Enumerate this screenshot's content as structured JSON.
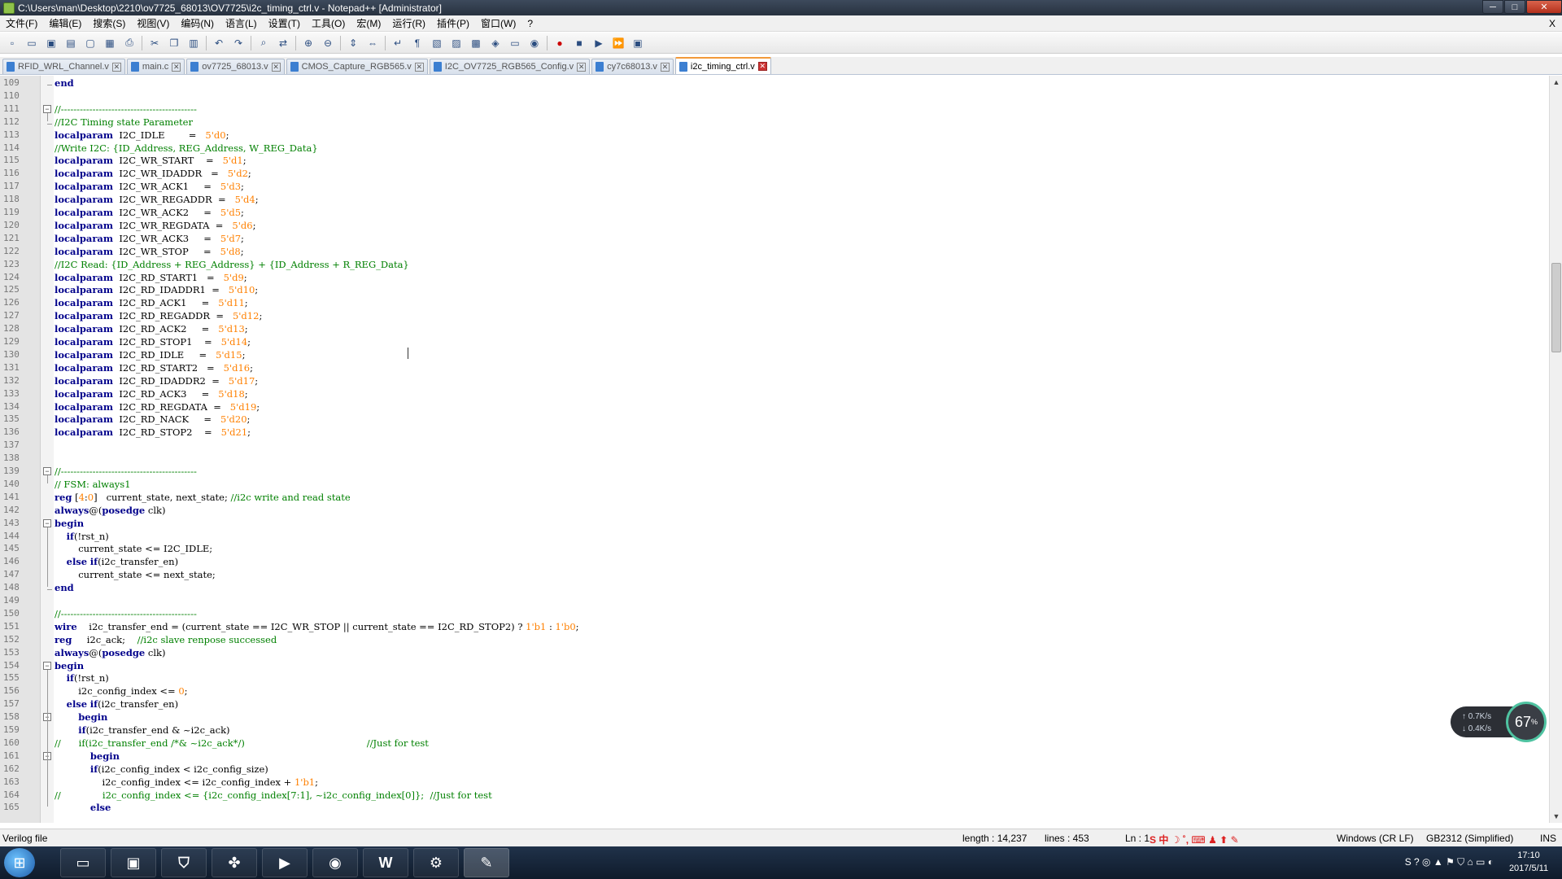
{
  "window": {
    "title": "C:\\Users\\man\\Desktop\\2210\\ov7725_68013\\OV7725\\i2c_timing_ctrl.v - Notepad++ [Administrator]",
    "minimize": "─",
    "maximize": "□",
    "close": "✕"
  },
  "menu": [
    "文件(F)",
    "编辑(E)",
    "搜索(S)",
    "视图(V)",
    "编码(N)",
    "语言(L)",
    "设置(T)",
    "工具(O)",
    "宏(M)",
    "运行(R)",
    "插件(P)",
    "窗口(W)",
    "?"
  ],
  "menu_close": "X",
  "tabs": [
    {
      "label": "RFID_WRL_Channel.v",
      "active": false
    },
    {
      "label": "main.c",
      "active": false
    },
    {
      "label": "ov7725_68013.v",
      "active": false
    },
    {
      "label": "CMOS_Capture_RGB565.v",
      "active": false
    },
    {
      "label": "I2C_OV7725_RGB565_Config.v",
      "active": false
    },
    {
      "label": "cy7c68013.v",
      "active": false
    },
    {
      "label": "i2c_timing_ctrl.v",
      "active": true
    }
  ],
  "code_lines": [
    {
      "n": "109",
      "t": "end"
    },
    {
      "n": "110",
      "t": ""
    },
    {
      "n": "111",
      "t": "//-------------------------------------------"
    },
    {
      "n": "112",
      "t": "//I2C Timing state Parameter"
    },
    {
      "n": "113",
      "t": "localparam  I2C_IDLE        =   5'd0;"
    },
    {
      "n": "114",
      "t": "//Write I2C: {ID_Address, REG_Address, W_REG_Data}"
    },
    {
      "n": "115",
      "t": "localparam  I2C_WR_START    =   5'd1;"
    },
    {
      "n": "116",
      "t": "localparam  I2C_WR_IDADDR   =   5'd2;"
    },
    {
      "n": "117",
      "t": "localparam  I2C_WR_ACK1     =   5'd3;"
    },
    {
      "n": "118",
      "t": "localparam  I2C_WR_REGADDR  =   5'd4;"
    },
    {
      "n": "119",
      "t": "localparam  I2C_WR_ACK2     =   5'd5;"
    },
    {
      "n": "120",
      "t": "localparam  I2C_WR_REGDATA  =   5'd6;"
    },
    {
      "n": "121",
      "t": "localparam  I2C_WR_ACK3     =   5'd7;"
    },
    {
      "n": "122",
      "t": "localparam  I2C_WR_STOP     =   5'd8;"
    },
    {
      "n": "123",
      "t": "//I2C Read: {ID_Address + REG_Address} + {ID_Address + R_REG_Data}"
    },
    {
      "n": "124",
      "t": "localparam  I2C_RD_START1   =   5'd9;"
    },
    {
      "n": "125",
      "t": "localparam  I2C_RD_IDADDR1  =   5'd10;"
    },
    {
      "n": "126",
      "t": "localparam  I2C_RD_ACK1     =   5'd11;"
    },
    {
      "n": "127",
      "t": "localparam  I2C_RD_REGADDR  =   5'd12;"
    },
    {
      "n": "128",
      "t": "localparam  I2C_RD_ACK2     =   5'd13;"
    },
    {
      "n": "129",
      "t": "localparam  I2C_RD_STOP1    =   5'd14;"
    },
    {
      "n": "130",
      "t": "localparam  I2C_RD_IDLE     =   5'd15;"
    },
    {
      "n": "131",
      "t": "localparam  I2C_RD_START2   =   5'd16;"
    },
    {
      "n": "132",
      "t": "localparam  I2C_RD_IDADDR2  =   5'd17;"
    },
    {
      "n": "133",
      "t": "localparam  I2C_RD_ACK3     =   5'd18;"
    },
    {
      "n": "134",
      "t": "localparam  I2C_RD_REGDATA  =   5'd19;"
    },
    {
      "n": "135",
      "t": "localparam  I2C_RD_NACK     =   5'd20;"
    },
    {
      "n": "136",
      "t": "localparam  I2C_RD_STOP2    =   5'd21;"
    },
    {
      "n": "137",
      "t": ""
    },
    {
      "n": "138",
      "t": ""
    },
    {
      "n": "139",
      "t": "//-------------------------------------------"
    },
    {
      "n": "140",
      "t": "// FSM: always1"
    },
    {
      "n": "141",
      "t": "reg [4:0]   current_state, next_state; //i2c write and read state"
    },
    {
      "n": "142",
      "t": "always@(posedge clk)"
    },
    {
      "n": "143",
      "t": "begin"
    },
    {
      "n": "144",
      "t": "    if(!rst_n)"
    },
    {
      "n": "145",
      "t": "        current_state <= I2C_IDLE;"
    },
    {
      "n": "146",
      "t": "    else if(i2c_transfer_en)"
    },
    {
      "n": "147",
      "t": "        current_state <= next_state;"
    },
    {
      "n": "148",
      "t": "end"
    },
    {
      "n": "149",
      "t": ""
    },
    {
      "n": "150",
      "t": "//-------------------------------------------"
    },
    {
      "n": "151",
      "t": "wire    i2c_transfer_end = (current_state == I2C_WR_STOP || current_state == I2C_RD_STOP2) ? 1'b1 : 1'b0;"
    },
    {
      "n": "152",
      "t": "reg     i2c_ack;    //i2c slave renpose successed"
    },
    {
      "n": "153",
      "t": "always@(posedge clk)"
    },
    {
      "n": "154",
      "t": "begin"
    },
    {
      "n": "155",
      "t": "    if(!rst_n)"
    },
    {
      "n": "156",
      "t": "        i2c_config_index <= 0;"
    },
    {
      "n": "157",
      "t": "    else if(i2c_transfer_en)"
    },
    {
      "n": "158",
      "t": "        begin"
    },
    {
      "n": "159",
      "t": "        if(i2c_transfer_end & ~i2c_ack)"
    },
    {
      "n": "160",
      "t": "//      if(i2c_transfer_end /*& ~i2c_ack*/)                                         //Just for test"
    },
    {
      "n": "161",
      "t": "            begin"
    },
    {
      "n": "162",
      "t": "            if(i2c_config_index < i2c_config_size)"
    },
    {
      "n": "163",
      "t": "                i2c_config_index <= i2c_config_index + 1'b1;"
    },
    {
      "n": "164",
      "t": "//              i2c_config_index <= {i2c_config_index[7:1], ~i2c_config_index[0]};  //Just for test"
    },
    {
      "n": "165",
      "t": "            else"
    }
  ],
  "status": {
    "file_type": "Verilog file",
    "length": "length : 14,237",
    "lines": "lines : 453",
    "position": "Ln : 1",
    "eol": "Windows (CR LF)",
    "encoding": "GB2312 (Simplified)",
    "mode": "INS"
  },
  "net_widget": {
    "up": "0.7K/s",
    "down": "0.4K/s",
    "percent": "67",
    "percent_unit": "%"
  },
  "taskbar": {
    "apps": [
      "file-explorer",
      "terminal",
      "security-shield",
      "color-app",
      "media-player",
      "firefox",
      "word",
      "network-tool",
      "notepad-plus-plus"
    ],
    "word_label": "W",
    "clock_time": "17:10",
    "clock_date": "2017/5/11"
  }
}
